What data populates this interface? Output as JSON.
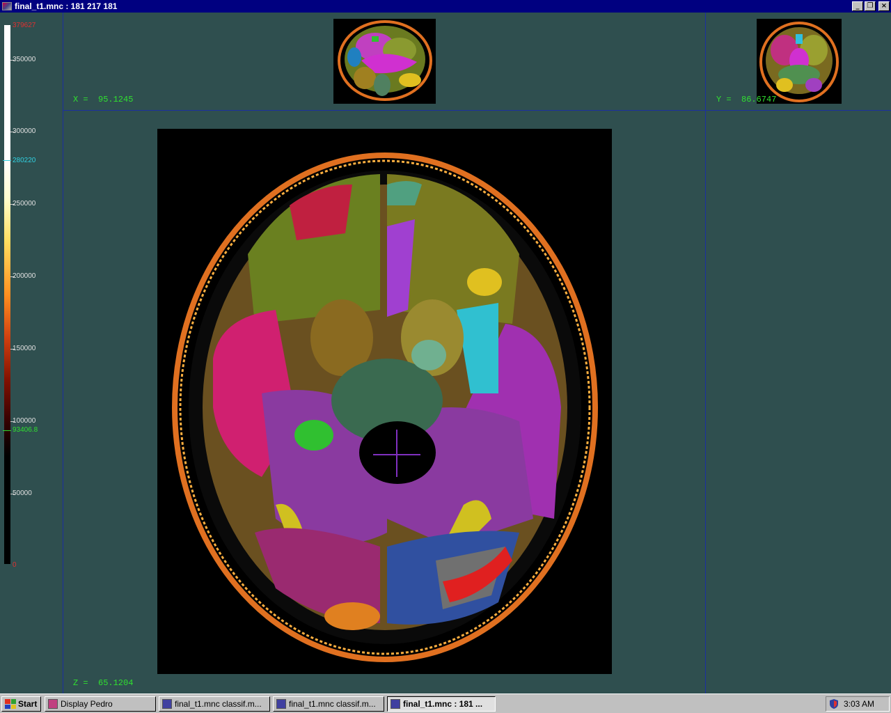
{
  "window": {
    "title": "final_t1.mnc : 181 217 181",
    "minimize": "_",
    "maximize": "❐",
    "close": "×"
  },
  "colorbar": {
    "labels": {
      "top": "379627",
      "v350000": "350000",
      "v300000": "300000",
      "upper_marker": "280220",
      "v250000": "250000",
      "v200000": "200000",
      "v150000": "150000",
      "v100000": "100000",
      "lower_marker": "93406.8",
      "v50000": "50000",
      "bottom": "0"
    }
  },
  "views": {
    "sagittal": {
      "coord": "X =  95.1245"
    },
    "coronal": {
      "coord": "Y =  86.6747"
    },
    "transverse": {
      "coord": "Z =  65.1204"
    }
  },
  "taskbar": {
    "start": "Start",
    "buttons": [
      {
        "label": "Display Pedro"
      },
      {
        "label": "final_t1.mnc classif.m..."
      },
      {
        "label": "final_t1.mnc classif.m..."
      },
      {
        "label": "final_t1.mnc : 181 ..."
      }
    ],
    "clock": "3:03 AM"
  }
}
